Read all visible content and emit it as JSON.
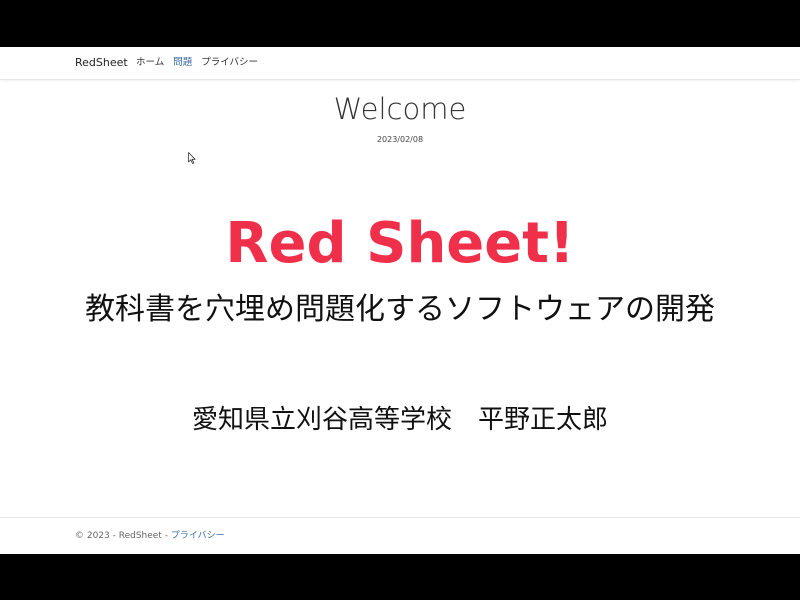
{
  "navbar": {
    "brand": "RedSheet",
    "links": [
      {
        "label": "ホーム",
        "active": false
      },
      {
        "label": "問題",
        "active": true
      },
      {
        "label": "プライバシー",
        "active": false
      }
    ]
  },
  "main": {
    "welcome": "Welcome",
    "date": "2023/02/08",
    "headline": "Red Sheet!",
    "subtitle": "教科書を穴埋め問題化するソフトウェアの開発",
    "author": "愛知県立刈谷高等学校　平野正太郎"
  },
  "footer": {
    "text": "© 2023 - RedSheet - ",
    "privacy_link": "プライバシー"
  },
  "colors": {
    "headline": "#f0304a",
    "link": "#3a6ea5",
    "letterbox": "#000000"
  },
  "icons": {
    "cursor": "mouse-pointer-icon"
  }
}
